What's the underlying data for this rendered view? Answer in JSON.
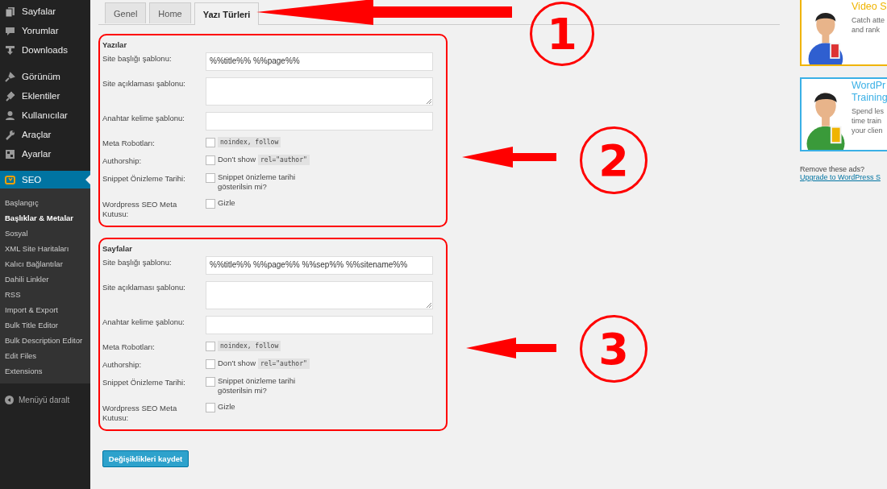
{
  "sidebar": {
    "items": [
      {
        "label": "Sayfalar",
        "selected": false
      },
      {
        "label": "Yorumlar",
        "selected": false
      },
      {
        "label": "Downloads",
        "selected": false
      },
      {
        "label": "Görünüm",
        "selected": false
      },
      {
        "label": "Eklentiler",
        "selected": false
      },
      {
        "label": "Kullanıcılar",
        "selected": false
      },
      {
        "label": "Araçlar",
        "selected": false
      },
      {
        "label": "Ayarlar",
        "selected": false
      },
      {
        "label": "SEO",
        "selected": true
      }
    ],
    "submenu": [
      {
        "label": "Başlangıç",
        "selected": false
      },
      {
        "label": "Başlıklar & Metalar",
        "selected": true
      },
      {
        "label": "Sosyal",
        "selected": false
      },
      {
        "label": "XML Site Haritaları",
        "selected": false
      },
      {
        "label": "Kalıcı Bağlantılar",
        "selected": false
      },
      {
        "label": "Dahili Linkler",
        "selected": false
      },
      {
        "label": "RSS",
        "selected": false
      },
      {
        "label": "Import & Export",
        "selected": false
      },
      {
        "label": "Bulk Title Editor",
        "selected": false
      },
      {
        "label": "Bulk Description Editor",
        "selected": false
      },
      {
        "label": "Edit Files",
        "selected": false
      },
      {
        "label": "Extensions",
        "selected": false
      }
    ],
    "collapse": "Menüyü daralt"
  },
  "tabs": [
    {
      "label": "Genel",
      "selected": false
    },
    {
      "label": "Home",
      "selected": false
    },
    {
      "label": "Yazı Türleri",
      "selected": true
    }
  ],
  "sections": [
    {
      "heading": "Yazılar",
      "rows": [
        {
          "kind": "text",
          "label": "Site başlığı şablonu:",
          "value": "%%title%% %%page%%"
        },
        {
          "kind": "textarea",
          "label": "Site açıklaması şablonu:"
        },
        {
          "kind": "text",
          "label": "Anahtar kelime şablonu:"
        },
        {
          "kind": "checkbox",
          "label": "Meta Robotları:",
          "checked": false,
          "code": "noindex, follow"
        },
        {
          "kind": "checkbox",
          "label": "Authorship:",
          "checked": false,
          "text": "Don’t show",
          "code": "rel=\"author\""
        },
        {
          "kind": "checkbox",
          "label": "Snippet Önizleme Tarihi:",
          "checked": false,
          "text": "Snippet önizleme tarihi gösterilsin mi?"
        },
        {
          "kind": "checkbox",
          "label": "Wordpress SEO Meta Kutusu:",
          "checked": false,
          "text": "Gizle"
        }
      ]
    },
    {
      "heading": "Sayfalar",
      "rows": [
        {
          "kind": "text",
          "label": "Site başlığı şablonu:",
          "value": "%%title%% %%page%% %%sep%% %%sitename%%"
        },
        {
          "kind": "textarea",
          "label": "Site açıklaması şablonu:"
        },
        {
          "kind": "text",
          "label": "Anahtar kelime şablonu:"
        },
        {
          "kind": "checkbox",
          "label": "Meta Robotları:",
          "checked": false,
          "code": "noindex, follow"
        },
        {
          "kind": "checkbox",
          "label": "Authorship:",
          "checked": false,
          "text": "Don’t show",
          "code": "rel=\"author\""
        },
        {
          "kind": "checkbox",
          "label": "Snippet Önizleme Tarihi:",
          "checked": false,
          "text": "Snippet önizleme tarihi gösterilsin mi?"
        },
        {
          "kind": "checkbox",
          "label": "Wordpress SEO Meta Kutusu:",
          "checked": false,
          "text": "Gizle"
        }
      ]
    }
  ],
  "save_button": "Değişiklikleri kaydet",
  "ads": [
    {
      "title": "Video S",
      "lines": [
        "Catch atte",
        "and rank"
      ],
      "color": "#f0b400"
    },
    {
      "title": "WordPr",
      "title2": "Training",
      "lines": [
        "Spend les",
        "time train",
        "your clien"
      ],
      "color": "#3ab0e6"
    }
  ],
  "ads_note": "Remove these ads?",
  "ads_link": "Upgrade to WordPress S",
  "annotations": [
    {
      "number": "1"
    },
    {
      "number": "2"
    },
    {
      "number": "3"
    }
  ]
}
